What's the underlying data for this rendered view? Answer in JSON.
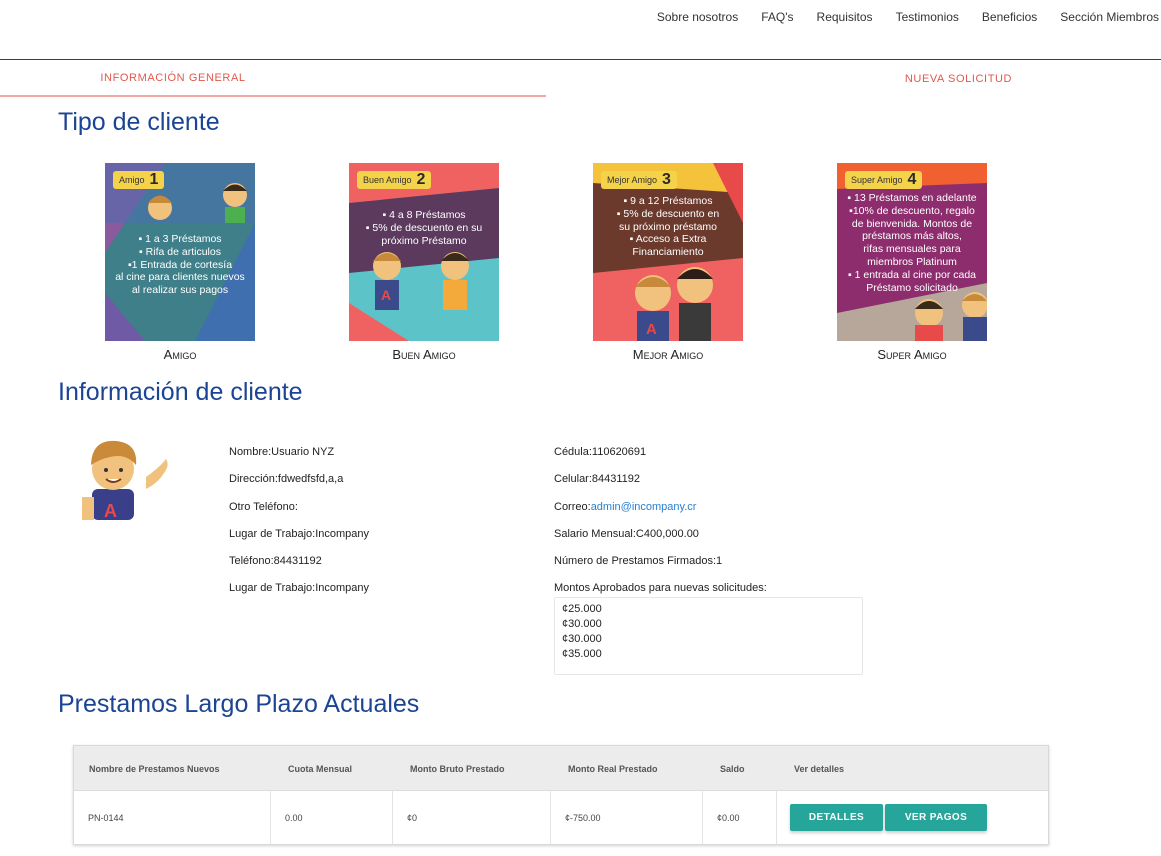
{
  "nav": {
    "items": [
      "Sobre nosotros",
      "FAQ's",
      "Requisitos",
      "Testimonios",
      "Beneficios",
      "Sección Miembros"
    ]
  },
  "tabs": {
    "general": "Información General",
    "nueva": "Nueva Solicitud"
  },
  "sections": {
    "tipo": "Tipo de cliente",
    "info": "Información de cliente",
    "prestamos": "Prestamos Largo Plazo Actuales"
  },
  "tiers": [
    {
      "badge_label": "Amigo",
      "badge_number": "1",
      "caption": "Amigo",
      "lines": [
        "▪ 1 a 3 Préstamos",
        "▪ Rifa de articulos",
        "▪1 Entrada de cortesía",
        "al cine para clientes nuevos",
        "al realizar sus pagos"
      ],
      "bg": "#3e7f8a"
    },
    {
      "badge_label": "Buen Amigo",
      "badge_number": "2",
      "caption": "Buen Amigo",
      "lines": [
        "▪ 4 a 8 Préstamos",
        "▪ 5% de descuento en su",
        "próximo  Préstamo"
      ],
      "bg": "#5b3a5e"
    },
    {
      "badge_label": "Mejor Amigo",
      "badge_number": "3",
      "caption": "Mejor Amigo",
      "lines": [
        "▪ 9 a 12 Préstamos",
        "▪ 5% de descuento en",
        "su próximo  préstamo",
        "▪ Acceso a Extra",
        "Financiamiento"
      ],
      "bg": "#6b3a2c"
    },
    {
      "badge_label": "Super Amigo",
      "badge_number": "4",
      "caption": "Super Amigo",
      "lines": [
        "▪ 13 Préstamos en adelante",
        "▪10% de descuento, regalo",
        "de bienvenida. Montos de",
        "préstamos más altos,",
        "rifas mensuales para",
        "miembros Platinum",
        "▪ 1 entrada al cine por cada",
        "Préstamo solicitado"
      ],
      "bg": "#8e2d6e"
    }
  ],
  "client": {
    "nombre": "Nombre:Usuario NYZ",
    "direccion": "Dirección:fdwedfsfd,a,a",
    "otro_telefono": "Otro Teléfono:",
    "lugar_trabajo_1": "Lugar de Trabajo:Incompany",
    "telefono": "Teléfono:84431192",
    "lugar_trabajo_2": "Lugar de Trabajo:Incompany",
    "cedula": "Cédula:110620691",
    "celular": "Celular:84431192",
    "correo_label": "Correo:",
    "correo": "admin@incompany.cr",
    "salario": "Salario Mensual:C400,000.00",
    "numero_prestamos": "Número de Prestamos Firmados:1",
    "montos_label": "Montos Aprobados para nuevas solicitudes:",
    "montos": [
      "¢25.000",
      "¢30.000",
      "¢30.000",
      "¢35.000"
    ]
  },
  "table": {
    "headers": [
      "Nombre de Prestamos Nuevos",
      "Cuota Mensual",
      "Monto Bruto Prestado",
      "Monto Real Prestado",
      "Saldo",
      "Ver detalles"
    ],
    "rows": [
      {
        "nombre": "PN-0144",
        "cuota": "0.00",
        "bruto": "¢0",
        "real": "¢-750.00",
        "saldo": "¢0.00"
      }
    ],
    "btn_detalles": "Detalles",
    "btn_pagos": "Ver pagos"
  },
  "colors": {
    "accent_blue": "#1c4494",
    "tab_red": "#e2584b",
    "button_teal": "#26a69a"
  }
}
